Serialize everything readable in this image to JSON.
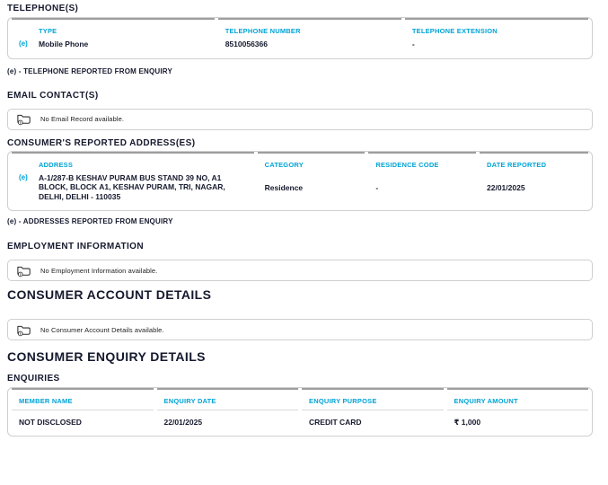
{
  "colors": {
    "accent_cyan": "#00A4D6",
    "heading_dark": "#15192D",
    "border_gray": "#cfcfcf",
    "table_top_border": "#9e9e9e"
  },
  "telephone": {
    "title": "TELEPHONE(S)",
    "columns": [
      "TYPE",
      "TELEPHONE NUMBER",
      "TELEPHONE EXTENSION"
    ],
    "rows": [
      {
        "marker": "(e)",
        "type": "Mobile Phone",
        "number": "8510056366",
        "extension": "-"
      }
    ],
    "footnote": "(e) - TELEPHONE REPORTED FROM ENQUIRY"
  },
  "email": {
    "title": "EMAIL CONTACT(S)",
    "empty_message": "No Email Record available."
  },
  "addresses": {
    "title": "CONSUMER'S REPORTED ADDRESS(ES)",
    "columns": [
      "ADDRESS",
      "CATEGORY",
      "RESIDENCE CODE",
      "DATE REPORTED"
    ],
    "rows": [
      {
        "marker": "(e)",
        "address": "A-1/287-B KESHAV PURAM BUS STAND 39 NO, A1 BLOCK, BLOCK A1, KESHAV PURAM, TRI, NAGAR, DELHI, DELHI - 110035",
        "category": "Residence",
        "residence_code": "-",
        "date_reported": "22/01/2025"
      }
    ],
    "footnote": "(e) - ADDRESSES REPORTED FROM ENQUIRY"
  },
  "employment": {
    "title": "EMPLOYMENT INFORMATION",
    "empty_message": "No Employment Information available."
  },
  "account": {
    "title": "CONSUMER ACCOUNT DETAILS",
    "empty_message": "No Consumer Account Details available."
  },
  "enquiry": {
    "title": "CONSUMER ENQUIRY DETAILS",
    "subtitle": "ENQUIRIES",
    "columns": [
      "MEMBER NAME",
      "ENQUIRY DATE",
      "ENQUIRY PURPOSE",
      "ENQUIRY AMOUNT"
    ],
    "rows": [
      {
        "member_name": "NOT DISCLOSED",
        "enquiry_date": "22/01/2025",
        "enquiry_purpose": "CREDIT CARD",
        "enquiry_amount": "₹ 1,000"
      }
    ]
  }
}
